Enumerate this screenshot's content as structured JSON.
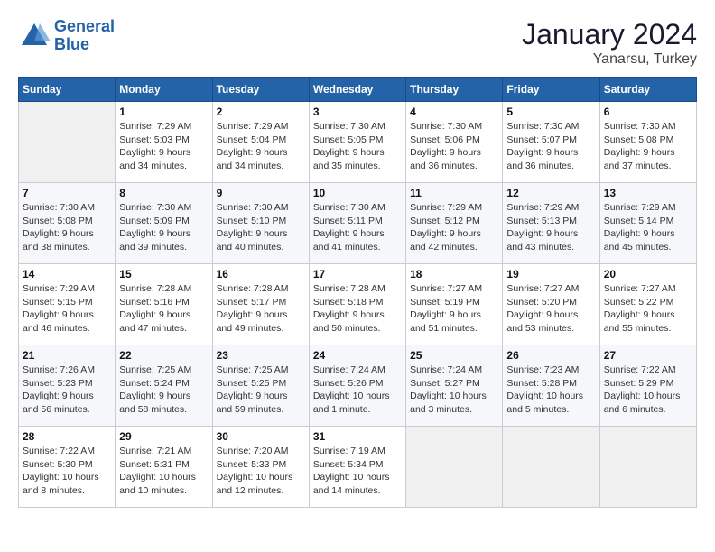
{
  "header": {
    "logo_line1": "General",
    "logo_line2": "Blue",
    "title": "January 2024",
    "subtitle": "Yanarsu, Turkey"
  },
  "weekdays": [
    "Sunday",
    "Monday",
    "Tuesday",
    "Wednesday",
    "Thursday",
    "Friday",
    "Saturday"
  ],
  "weeks": [
    [
      {
        "day": "",
        "empty": true
      },
      {
        "day": "1",
        "sunrise": "7:29 AM",
        "sunset": "5:03 PM",
        "daylight": "9 hours and 34 minutes."
      },
      {
        "day": "2",
        "sunrise": "7:29 AM",
        "sunset": "5:04 PM",
        "daylight": "9 hours and 34 minutes."
      },
      {
        "day": "3",
        "sunrise": "7:30 AM",
        "sunset": "5:05 PM",
        "daylight": "9 hours and 35 minutes."
      },
      {
        "day": "4",
        "sunrise": "7:30 AM",
        "sunset": "5:06 PM",
        "daylight": "9 hours and 36 minutes."
      },
      {
        "day": "5",
        "sunrise": "7:30 AM",
        "sunset": "5:07 PM",
        "daylight": "9 hours and 36 minutes."
      },
      {
        "day": "6",
        "sunrise": "7:30 AM",
        "sunset": "5:08 PM",
        "daylight": "9 hours and 37 minutes."
      }
    ],
    [
      {
        "day": "7",
        "sunrise": "7:30 AM",
        "sunset": "5:08 PM",
        "daylight": "9 hours and 38 minutes."
      },
      {
        "day": "8",
        "sunrise": "7:30 AM",
        "sunset": "5:09 PM",
        "daylight": "9 hours and 39 minutes."
      },
      {
        "day": "9",
        "sunrise": "7:30 AM",
        "sunset": "5:10 PM",
        "daylight": "9 hours and 40 minutes."
      },
      {
        "day": "10",
        "sunrise": "7:30 AM",
        "sunset": "5:11 PM",
        "daylight": "9 hours and 41 minutes."
      },
      {
        "day": "11",
        "sunrise": "7:29 AM",
        "sunset": "5:12 PM",
        "daylight": "9 hours and 42 minutes."
      },
      {
        "day": "12",
        "sunrise": "7:29 AM",
        "sunset": "5:13 PM",
        "daylight": "9 hours and 43 minutes."
      },
      {
        "day": "13",
        "sunrise": "7:29 AM",
        "sunset": "5:14 PM",
        "daylight": "9 hours and 45 minutes."
      }
    ],
    [
      {
        "day": "14",
        "sunrise": "7:29 AM",
        "sunset": "5:15 PM",
        "daylight": "9 hours and 46 minutes."
      },
      {
        "day": "15",
        "sunrise": "7:28 AM",
        "sunset": "5:16 PM",
        "daylight": "9 hours and 47 minutes."
      },
      {
        "day": "16",
        "sunrise": "7:28 AM",
        "sunset": "5:17 PM",
        "daylight": "9 hours and 49 minutes."
      },
      {
        "day": "17",
        "sunrise": "7:28 AM",
        "sunset": "5:18 PM",
        "daylight": "9 hours and 50 minutes."
      },
      {
        "day": "18",
        "sunrise": "7:27 AM",
        "sunset": "5:19 PM",
        "daylight": "9 hours and 51 minutes."
      },
      {
        "day": "19",
        "sunrise": "7:27 AM",
        "sunset": "5:20 PM",
        "daylight": "9 hours and 53 minutes."
      },
      {
        "day": "20",
        "sunrise": "7:27 AM",
        "sunset": "5:22 PM",
        "daylight": "9 hours and 55 minutes."
      }
    ],
    [
      {
        "day": "21",
        "sunrise": "7:26 AM",
        "sunset": "5:23 PM",
        "daylight": "9 hours and 56 minutes."
      },
      {
        "day": "22",
        "sunrise": "7:25 AM",
        "sunset": "5:24 PM",
        "daylight": "9 hours and 58 minutes."
      },
      {
        "day": "23",
        "sunrise": "7:25 AM",
        "sunset": "5:25 PM",
        "daylight": "9 hours and 59 minutes."
      },
      {
        "day": "24",
        "sunrise": "7:24 AM",
        "sunset": "5:26 PM",
        "daylight": "10 hours and 1 minute."
      },
      {
        "day": "25",
        "sunrise": "7:24 AM",
        "sunset": "5:27 PM",
        "daylight": "10 hours and 3 minutes."
      },
      {
        "day": "26",
        "sunrise": "7:23 AM",
        "sunset": "5:28 PM",
        "daylight": "10 hours and 5 minutes."
      },
      {
        "day": "27",
        "sunrise": "7:22 AM",
        "sunset": "5:29 PM",
        "daylight": "10 hours and 6 minutes."
      }
    ],
    [
      {
        "day": "28",
        "sunrise": "7:22 AM",
        "sunset": "5:30 PM",
        "daylight": "10 hours and 8 minutes."
      },
      {
        "day": "29",
        "sunrise": "7:21 AM",
        "sunset": "5:31 PM",
        "daylight": "10 hours and 10 minutes."
      },
      {
        "day": "30",
        "sunrise": "7:20 AM",
        "sunset": "5:33 PM",
        "daylight": "10 hours and 12 minutes."
      },
      {
        "day": "31",
        "sunrise": "7:19 AM",
        "sunset": "5:34 PM",
        "daylight": "10 hours and 14 minutes."
      },
      {
        "day": "",
        "empty": true
      },
      {
        "day": "",
        "empty": true
      },
      {
        "day": "",
        "empty": true
      }
    ]
  ]
}
